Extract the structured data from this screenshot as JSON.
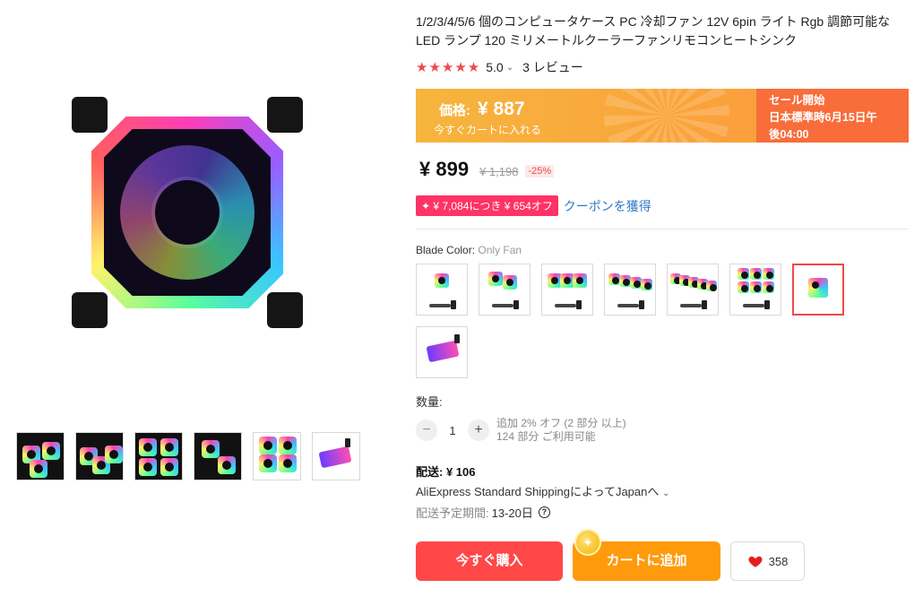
{
  "product": {
    "title": "1/2/3/4/5/6 個のコンピュータケース PC 冷却ファン 12V 6pin ライト Rgb 調節可能な LED ランプ 120 ミリメートルクーラーファンリモコンヒートシンク",
    "rating": {
      "stars": 5,
      "score": "5.0",
      "reviews": "3 レビュー"
    }
  },
  "promo": {
    "price_label": "価格:",
    "price": "¥ 887",
    "sub": "今すぐカートに入れる",
    "sale_line1": "セール開始",
    "sale_line2": "日本標準時6月15日午",
    "sale_line3": "後04:00"
  },
  "pricing": {
    "price": "¥ 899",
    "original": "¥ 1,198",
    "discount": "-25%"
  },
  "coupon": {
    "badge": "✦ ¥ 7,084につき ¥ 654オフ",
    "link": "クーポンを獲得"
  },
  "variant": {
    "label": "Blade Color:",
    "selected": "Only Fan"
  },
  "quantity": {
    "label": "数量:",
    "value": "1",
    "info_line1": "追加 2% オフ (2 部分 以上)",
    "info_line2": "124 部分 ご利用可能"
  },
  "shipping": {
    "label": "配送:",
    "price": "¥ 106",
    "method": "AliExpress Standard ShippingによってJapanへ",
    "eta_label": "配送予定期間:",
    "eta": "13-20日"
  },
  "actions": {
    "buy": "今すぐ購入",
    "cart": "カートに追加",
    "wishlist_count": "358"
  },
  "colors": {
    "accent_red": "#ff4747",
    "cart_orange": "#ff9a0c",
    "promo_orange": "#f86d3a",
    "link_blue": "#2e79c4",
    "coupon_pink": "#ff3366"
  }
}
